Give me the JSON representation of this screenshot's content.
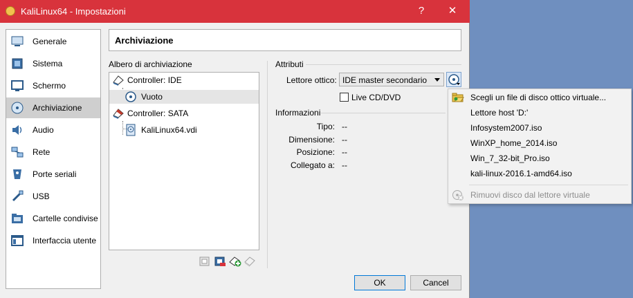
{
  "window": {
    "title": "KaliLinux64 - Impostazioni",
    "help_label": "?",
    "close_label": "✕"
  },
  "sidebar": {
    "items": [
      {
        "label": "Generale",
        "icon": "general-icon"
      },
      {
        "label": "Sistema",
        "icon": "system-icon"
      },
      {
        "label": "Schermo",
        "icon": "display-icon"
      },
      {
        "label": "Archiviazione",
        "icon": "storage-icon",
        "selected": true
      },
      {
        "label": "Audio",
        "icon": "audio-icon"
      },
      {
        "label": "Rete",
        "icon": "network-icon"
      },
      {
        "label": "Porte seriali",
        "icon": "serial-ports-icon"
      },
      {
        "label": "USB",
        "icon": "usb-icon"
      },
      {
        "label": "Cartelle condivise",
        "icon": "shared-folders-icon"
      },
      {
        "label": "Interfaccia utente",
        "icon": "user-interface-icon"
      }
    ]
  },
  "page_title": "Archiviazione",
  "storage_tree": {
    "label": "Albero di archiviazione",
    "controllers": [
      {
        "label": "Controller: IDE",
        "children": [
          {
            "label": "Vuoto",
            "type": "optical",
            "selected": true
          }
        ]
      },
      {
        "label": "Controller: SATA",
        "children": [
          {
            "label": "KaliLinux64.vdi",
            "type": "disk"
          }
        ]
      }
    ]
  },
  "attributes": {
    "label": "Attributi",
    "optical_drive_label": "Lettore ottico:",
    "optical_drive_value": "IDE master secondario",
    "live_cd_label": "Live CD/DVD",
    "live_cd_checked": false
  },
  "info": {
    "label": "Informazioni",
    "rows": [
      {
        "key": "Tipo:",
        "value": "--"
      },
      {
        "key": "Dimensione:",
        "value": "--"
      },
      {
        "key": "Posizione:",
        "value": "--"
      },
      {
        "key": "Collegato a:",
        "value": "--"
      }
    ]
  },
  "buttons": {
    "ok": "OK",
    "cancel": "Cancel"
  },
  "disc_menu": {
    "items": [
      {
        "label": "Scegli un file di disco ottico virtuale...",
        "icon": "folder-open-icon"
      },
      {
        "label": "Lettore host 'D:'"
      },
      {
        "label": "Infosystem2007.iso"
      },
      {
        "label": "WinXP_home_2014.iso"
      },
      {
        "label": "Win_7_32-bit_Pro.iso"
      },
      {
        "label": "kali-linux-2016.1-amd64.iso"
      }
    ],
    "remove_label": "Rimuovi disco dal lettore virtuale"
  },
  "colors": {
    "titlebar": "#d8333c",
    "desktop": "#6f8fbf",
    "selection": "#cfcfcf"
  }
}
